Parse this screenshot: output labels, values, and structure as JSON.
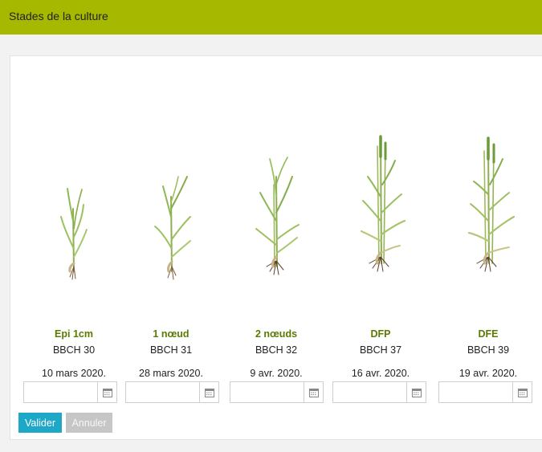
{
  "header": {
    "title": "Stades de la culture"
  },
  "stages": [
    {
      "name": "Epi 1cm",
      "code": "BBCH 30",
      "date": "10 mars 2020.",
      "input_value": ""
    },
    {
      "name": "1 nœud",
      "code": "BBCH 31",
      "date": "28 mars 2020.",
      "input_value": ""
    },
    {
      "name": "2 nœuds",
      "code": "BBCH 32",
      "date": "9 avr. 2020.",
      "input_value": ""
    },
    {
      "name": "DFP",
      "code": "BBCH 37",
      "date": "16 avr. 2020.",
      "input_value": ""
    },
    {
      "name": "DFE",
      "code": "BBCH 39",
      "date": "19 avr. 2020.",
      "input_value": ""
    }
  ],
  "actions": {
    "validate_label": "Valider",
    "cancel_label": "Annuler"
  },
  "colors": {
    "header": "#a6b800",
    "stage_name": "#5b7a00",
    "validate": "#1ea8c8",
    "cancel": "#c6c6c6"
  },
  "icons": {
    "date_picker": "calendar-icon",
    "plant": "wheat-plant-illustration"
  }
}
